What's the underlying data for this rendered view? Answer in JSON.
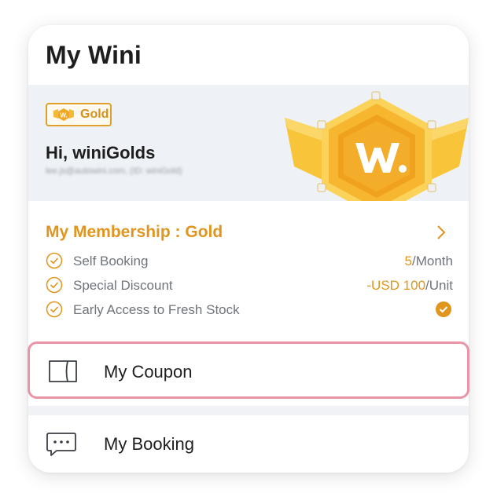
{
  "page": {
    "title": "My Wini"
  },
  "profile": {
    "tier_badge": "Gold",
    "greeting": "Hi, winiGolds",
    "email_line": "lee.js@autowini.com, (ID: winiGold)",
    "medal_icon": "gold-medal-w-logo"
  },
  "membership": {
    "title": "My Membership : Gold",
    "benefits": [
      {
        "label": "Self Booking",
        "value_accent": "5",
        "value_rest": "/Month"
      },
      {
        "label": "Special Discount",
        "value_accent": "-USD 100",
        "value_rest": "/Unit"
      },
      {
        "label": "Early Access to Fresh Stock",
        "value_icon": "filled-check-icon"
      }
    ]
  },
  "menu": {
    "coupon": {
      "label": "My Coupon",
      "icon": "ticket-icon"
    },
    "booking": {
      "label": "My Booking",
      "icon": "chat-bubble-icon"
    }
  },
  "colors": {
    "accent_gold": "#e0951e",
    "badge_border": "#e0a02a",
    "profile_bg": "#eef2f6",
    "highlight_border": "#e994a7"
  }
}
